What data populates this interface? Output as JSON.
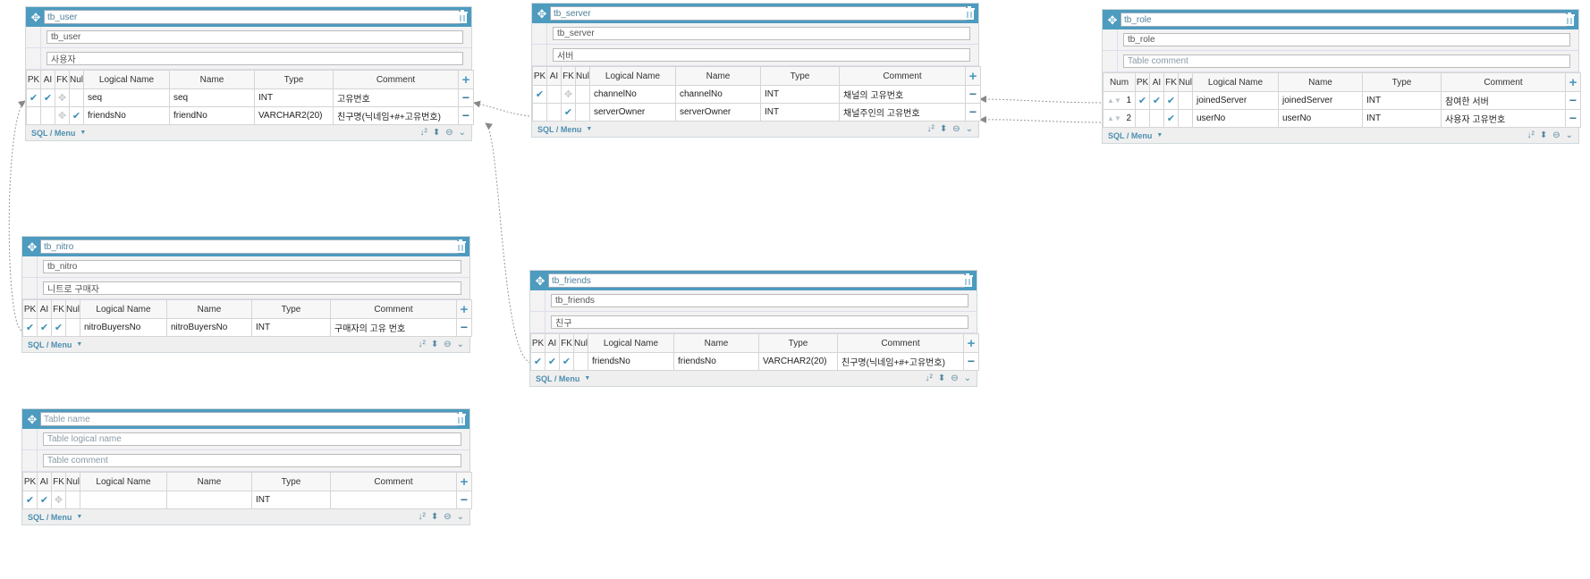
{
  "labels": {
    "pk": "PK",
    "ai": "AI",
    "fk": "FK",
    "null": "Null",
    "num": "Num",
    "logical_name": "Logical Name",
    "name": "Name",
    "type": "Type",
    "comment": "Comment",
    "sql_menu": "SQL / Menu"
  },
  "colors": {
    "header": "#4d9bbf",
    "check": "#3a8fb6",
    "accent": "#4d8fb0"
  },
  "tables": {
    "tb_user": {
      "name": "tb_user",
      "logical": "tb_user",
      "comment": "사용자",
      "rows": [
        {
          "logical": "seq",
          "name": "seq",
          "type": "INT",
          "comment": "고유번호"
        },
        {
          "logical": "friendsNo",
          "name": "friendNo",
          "type": "VARCHAR2(20)",
          "comment": "친구명(닉네임+#+고유번호)"
        }
      ]
    },
    "tb_server": {
      "name": "tb_server",
      "logical": "tb_server",
      "comment": "서버",
      "rows": [
        {
          "logical": "channelNo",
          "name": "channelNo",
          "type": "INT",
          "comment": "채널의 고유번호"
        },
        {
          "logical": "serverOwner",
          "name": "serverOwner",
          "type": "INT",
          "comment": "채널주인의 고유번호"
        }
      ]
    },
    "tb_role": {
      "name": "tb_role",
      "logical": "tb_role",
      "comment": "",
      "comment_placeholder": "Table comment",
      "rows": [
        {
          "num": "1",
          "logical": "joinedServer",
          "name": "joinedServer",
          "type": "INT",
          "comment": "참여한 서버"
        },
        {
          "num": "2",
          "logical": "userNo",
          "name": "userNo",
          "type": "INT",
          "comment": "사용자 고유번호"
        }
      ]
    },
    "tb_nitro": {
      "name": "tb_nitro",
      "logical": "tb_nitro",
      "comment": "니트로 구매자",
      "rows": [
        {
          "logical": "nitroBuyersNo",
          "name": "nitroBuyersNo",
          "type": "INT",
          "comment": "구매자의 고유 번호"
        }
      ]
    },
    "tb_friends": {
      "name": "tb_friends",
      "logical": "tb_friends",
      "comment": "친구",
      "rows": [
        {
          "logical": "friendsNo",
          "name": "friendsNo",
          "type": "VARCHAR2(20)",
          "comment": "친구명(닉네임+#+고유번호)"
        }
      ]
    },
    "new_table": {
      "name_placeholder": "Table name",
      "logical_placeholder": "Table logical name",
      "comment_placeholder": "Table comment",
      "rows": [
        {
          "logical": "",
          "name": "",
          "type": "INT",
          "comment": ""
        }
      ]
    }
  }
}
